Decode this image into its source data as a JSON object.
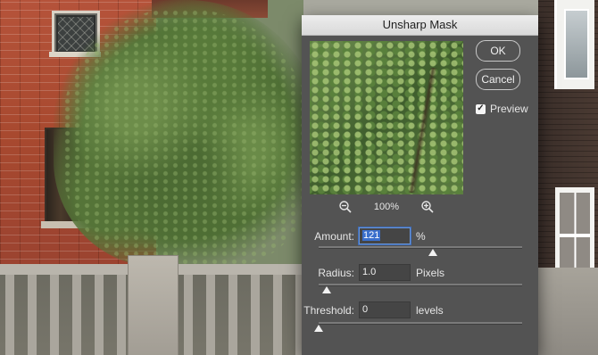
{
  "dialog": {
    "title": "Unsharp Mask",
    "ok_label": "OK",
    "cancel_label": "Cancel",
    "preview_label": "Preview",
    "preview_checked": true,
    "preview_check_glyph": "✓",
    "zoom_out_icon": "zoom-out-icon",
    "zoom_in_icon": "zoom-in-icon",
    "zoom_level": "100%"
  },
  "fields": {
    "amount": {
      "label": "Amount:",
      "value": "121",
      "unit": "%",
      "slider_fraction": 0.56
    },
    "radius": {
      "label": "Radius:",
      "value": "1.0",
      "unit": "Pixels",
      "slider_fraction": 0.04
    },
    "threshold": {
      "label": "Threshold:",
      "value": "0",
      "unit": "levels",
      "slider_fraction": 0.0
    }
  },
  "colors": {
    "dialog_bg": "#535353",
    "titlebar_bg": "#e3e3e3",
    "focus_accent": "#3a6fcc"
  }
}
